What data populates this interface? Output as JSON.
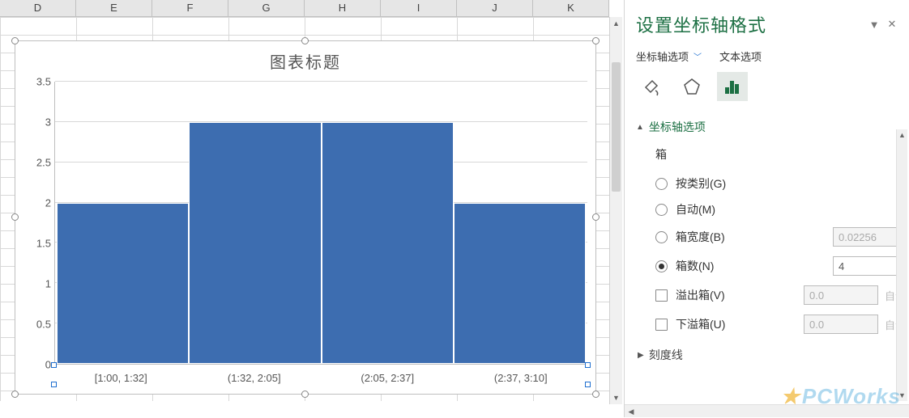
{
  "columns": [
    "D",
    "E",
    "F",
    "G",
    "H",
    "I",
    "J",
    "K"
  ],
  "chart_data": {
    "type": "bar",
    "title": "图表标题",
    "categories": [
      "[1:00, 1:32]",
      "(1:32, 2:05]",
      "(2:05, 2:37]",
      "(2:37, 3:10]"
    ],
    "values": [
      2,
      3,
      3,
      2
    ],
    "ylim": [
      0,
      3.5
    ],
    "yticks": [
      "0",
      "0.5",
      "1",
      "1.5",
      "2",
      "2.5",
      "3",
      "3.5"
    ]
  },
  "pane": {
    "title": "设置坐标轴格式",
    "tab_axis_options": "坐标轴选项",
    "tab_text_options": "文本选项",
    "section_axis_options": "坐标轴选项",
    "bins_label": "箱",
    "by_category": "按类别(G)",
    "automatic": "自动(M)",
    "bin_width": "箱宽度(B)",
    "bin_width_value": "0.02256",
    "bin_count": "箱数(N)",
    "bin_count_value": "4",
    "overflow": "溢出箱(V)",
    "overflow_value": "0.0",
    "underflow": "下溢箱(U)",
    "underflow_value": "0.0",
    "auto_text": "自动",
    "tick_marks": "刻度线"
  },
  "watermark": "PCWorks"
}
